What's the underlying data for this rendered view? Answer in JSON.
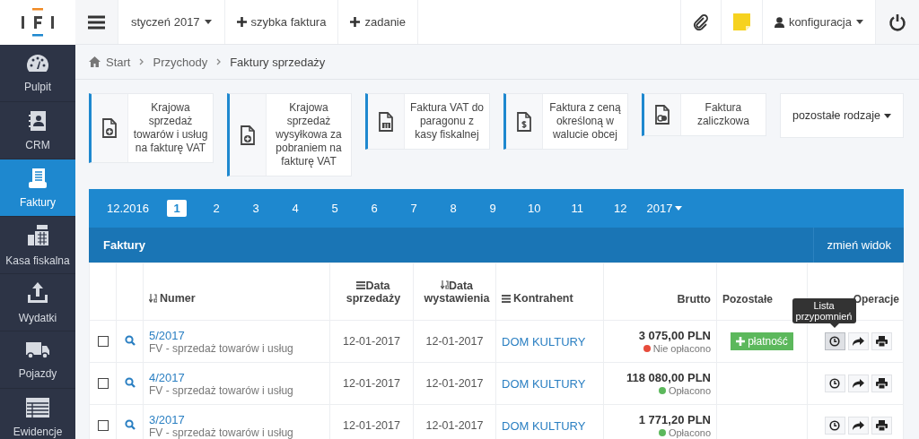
{
  "topbar": {
    "period": "styczeń 2017",
    "actions": [
      {
        "label": "szybka faktura"
      },
      {
        "label": "zadanie"
      }
    ],
    "user": "konfiguracja"
  },
  "nav": [
    {
      "label": "Pulpit",
      "selected": false
    },
    {
      "label": "CRM",
      "selected": false
    },
    {
      "label": "Faktury",
      "selected": true
    },
    {
      "label": "Kasa fiskalna",
      "selected": false
    },
    {
      "label": "Wydatki",
      "selected": false
    },
    {
      "label": "Pojazdy",
      "selected": false
    },
    {
      "label": "Ewidencje",
      "selected": false
    }
  ],
  "breadcrumb": [
    "Start",
    "Przychody",
    "Faktury sprzedaży"
  ],
  "invoice_types": [
    {
      "label": "Krajowa sprzedaż towarów i usług na fakturę VAT"
    },
    {
      "label": "Krajowa sprzedaż wysyłkowa za pobraniem na fakturę VAT"
    },
    {
      "label": "Faktura VAT do paragonu z kasy fiskalnej"
    },
    {
      "label": "Faktura z ceną określoną w walucie obcej"
    },
    {
      "label": "Faktura zaliczkowa"
    }
  ],
  "more_types": "pozostałe rodzaje",
  "months": {
    "previous": "12.2016",
    "pages": [
      {
        "label": "1",
        "selected": true
      },
      {
        "label": "2",
        "selected": false
      },
      {
        "label": "3",
        "selected": false
      },
      {
        "label": "4",
        "selected": false
      },
      {
        "label": "5",
        "selected": false
      },
      {
        "label": "6",
        "selected": false
      },
      {
        "label": "7",
        "selected": false
      },
      {
        "label": "8",
        "selected": false
      },
      {
        "label": "9",
        "selected": false
      },
      {
        "label": "10",
        "selected": false
      },
      {
        "label": "11",
        "selected": false
      },
      {
        "label": "12",
        "selected": false
      }
    ],
    "year": "2017"
  },
  "table": {
    "title": "Faktury",
    "change_view": "zmień widok",
    "columns": [
      {
        "label": "Numer",
        "kind": "sort"
      },
      {
        "label": "Data sprzedaży",
        "kind": "list"
      },
      {
        "label": "Data wystawienia",
        "kind": "sort"
      },
      {
        "label": "Kontrahent",
        "kind": "list"
      },
      {
        "label": "Brutto",
        "kind": "plain"
      },
      {
        "label": "Pozostałe",
        "kind": "plain"
      },
      {
        "label": "Operacje",
        "kind": "plain"
      }
    ],
    "rows": [
      {
        "checked": false,
        "number": "5/2017",
        "type": "FV - sprzedaż towarów i usług",
        "sale_date": "12-01-2017",
        "issue_date": "12-01-2017",
        "contractor": "DOM KULTURY",
        "gross": "3 075,00 PLN",
        "status": "Nie opłacono",
        "color": "#e74c3c",
        "payment": "płatność",
        "reminder_active": true
      },
      {
        "checked": false,
        "number": "4/2017",
        "type": "FV - sprzedaż towarów i usług",
        "sale_date": "12-01-2017",
        "issue_date": "12-01-2017",
        "contractor": "DOM KULTURY",
        "gross": "118 080,00 PLN",
        "status": "Opłacono",
        "color": "#5cb85c",
        "reminder_active": false
      },
      {
        "checked": false,
        "number": "3/2017",
        "type": "FV - sprzedaż towarów i usług",
        "sale_date": "12-01-2017",
        "issue_date": "12-01-2017",
        "contractor": "DOM KULTURY",
        "gross": "1 771,20 PLN",
        "status": "Opłacono",
        "color": "#5cb85c",
        "reminder_active": false
      }
    ],
    "tooltip": "Lista przypomnień"
  }
}
